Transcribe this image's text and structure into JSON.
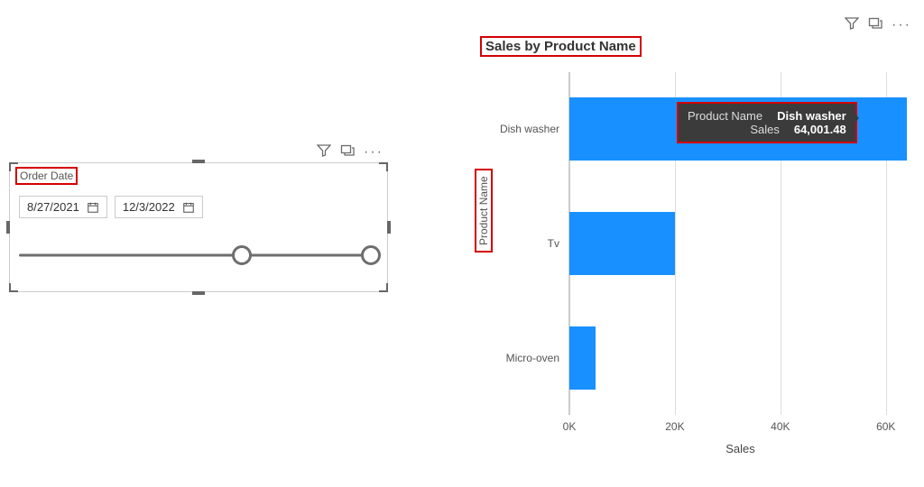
{
  "slicer": {
    "title": "Order Date",
    "from": "8/27/2021",
    "to": "12/3/2022",
    "slider_from_pct": 62,
    "slider_to_pct": 98
  },
  "chart": {
    "title": "Sales by Product Name",
    "y_axis_title": "Product Name",
    "x_axis_title": "Sales",
    "ticks": [
      "0K",
      "20K",
      "40K",
      "60K"
    ],
    "categories": [
      "Dish washer",
      "Tv",
      "Micro-oven"
    ]
  },
  "tooltip": {
    "k1": "Product Name",
    "v1": "Dish washer",
    "k2": "Sales",
    "v2": "64,001.48"
  },
  "chart_data": {
    "type": "bar",
    "orientation": "horizontal",
    "title": "Sales by Product Name",
    "xlabel": "Sales",
    "ylabel": "Product Name",
    "xlim": [
      0,
      65000
    ],
    "x_ticks": [
      0,
      20000,
      40000,
      60000
    ],
    "categories": [
      "Dish washer",
      "Tv",
      "Micro-oven"
    ],
    "values": [
      64001.48,
      20000,
      5000
    ],
    "color": "#1890ff",
    "tooltip": {
      "Product Name": "Dish washer",
      "Sales": 64001.48
    }
  }
}
